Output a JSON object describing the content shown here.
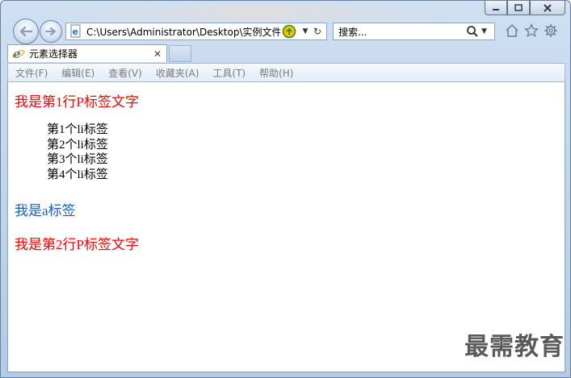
{
  "window": {
    "caption": {
      "minimize": "▭",
      "maximize": "▢",
      "close": "✕"
    }
  },
  "address_bar": {
    "url": "C:\\Users\\Administrator\\Desktop\\实例文件",
    "dropdown": "▼",
    "refresh": "↻"
  },
  "search": {
    "placeholder": "搜索...",
    "dropdown": "▼"
  },
  "tab": {
    "title": "元素选择器",
    "close": "✕"
  },
  "menu": {
    "items": [
      "文件(F)",
      "编辑(E)",
      "查看(V)",
      "收藏夹(A)",
      "工具(T)",
      "帮助(H)"
    ]
  },
  "page": {
    "p1": "我是第1行P标签文字",
    "li_items": [
      "第1个li标签",
      "第2个li标签",
      "第3个li标签",
      "第4个li标签"
    ],
    "a_text": "我是a标签",
    "p2": "我是第2行P标签文字",
    "watermark": "最需教育"
  },
  "colors": {
    "p_text": "#ff0000",
    "a_link": "#1a5fb4",
    "li_text": "#000000",
    "watermark": "#5a5a5a"
  }
}
